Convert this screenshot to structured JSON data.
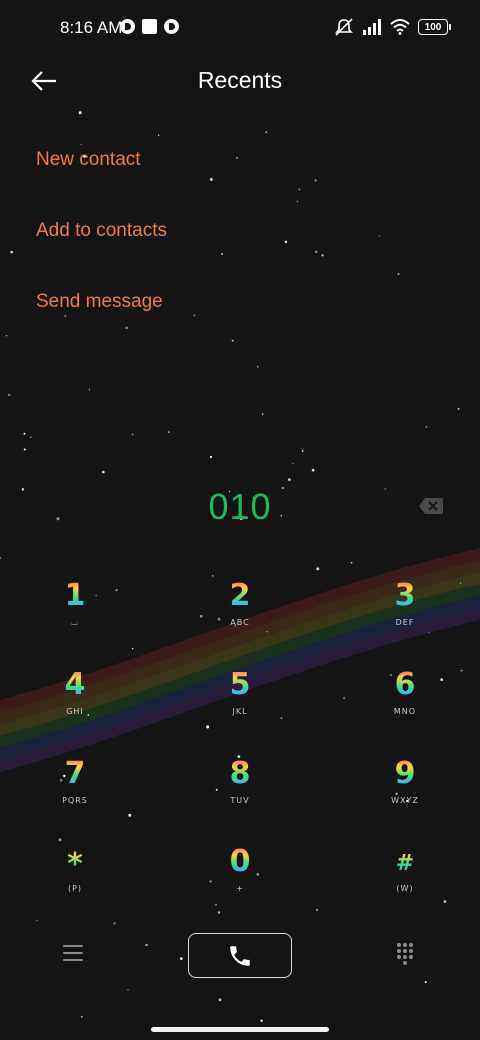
{
  "status_bar": {
    "time": "8:16 AM",
    "battery": "100",
    "icons": [
      "notification-icon",
      "square-notification-icon",
      "notification-icon",
      "mute-icon",
      "signal-icon",
      "wifi-icon",
      "battery-icon"
    ]
  },
  "header": {
    "title": "Recents",
    "back_icon": "back-arrow-icon"
  },
  "menu": [
    {
      "label": "New contact"
    },
    {
      "label": "Add to contacts"
    },
    {
      "label": "Send message"
    }
  ],
  "dialer": {
    "number": "010",
    "backspace_icon": "backspace-icon"
  },
  "keypad": [
    {
      "digit": "1",
      "letters": "⌴"
    },
    {
      "digit": "2",
      "letters": "ABC"
    },
    {
      "digit": "3",
      "letters": "DEF"
    },
    {
      "digit": "4",
      "letters": "GHI"
    },
    {
      "digit": "5",
      "letters": "JKL"
    },
    {
      "digit": "6",
      "letters": "MNO"
    },
    {
      "digit": "7",
      "letters": "PQRS"
    },
    {
      "digit": "8",
      "letters": "TUV"
    },
    {
      "digit": "9",
      "letters": "WXYZ"
    },
    {
      "digit": "*",
      "letters": "(P)"
    },
    {
      "digit": "0",
      "letters": "+"
    },
    {
      "digit": "#",
      "letters": "(W)"
    }
  ],
  "bottom_bar": {
    "menu_icon": "hamburger-menu-icon",
    "call_icon": "phone-icon",
    "dialpad_icon": "dialpad-icon"
  },
  "colors": {
    "accent": "#f07b45",
    "number": "#22b85b",
    "background": "#141414"
  }
}
